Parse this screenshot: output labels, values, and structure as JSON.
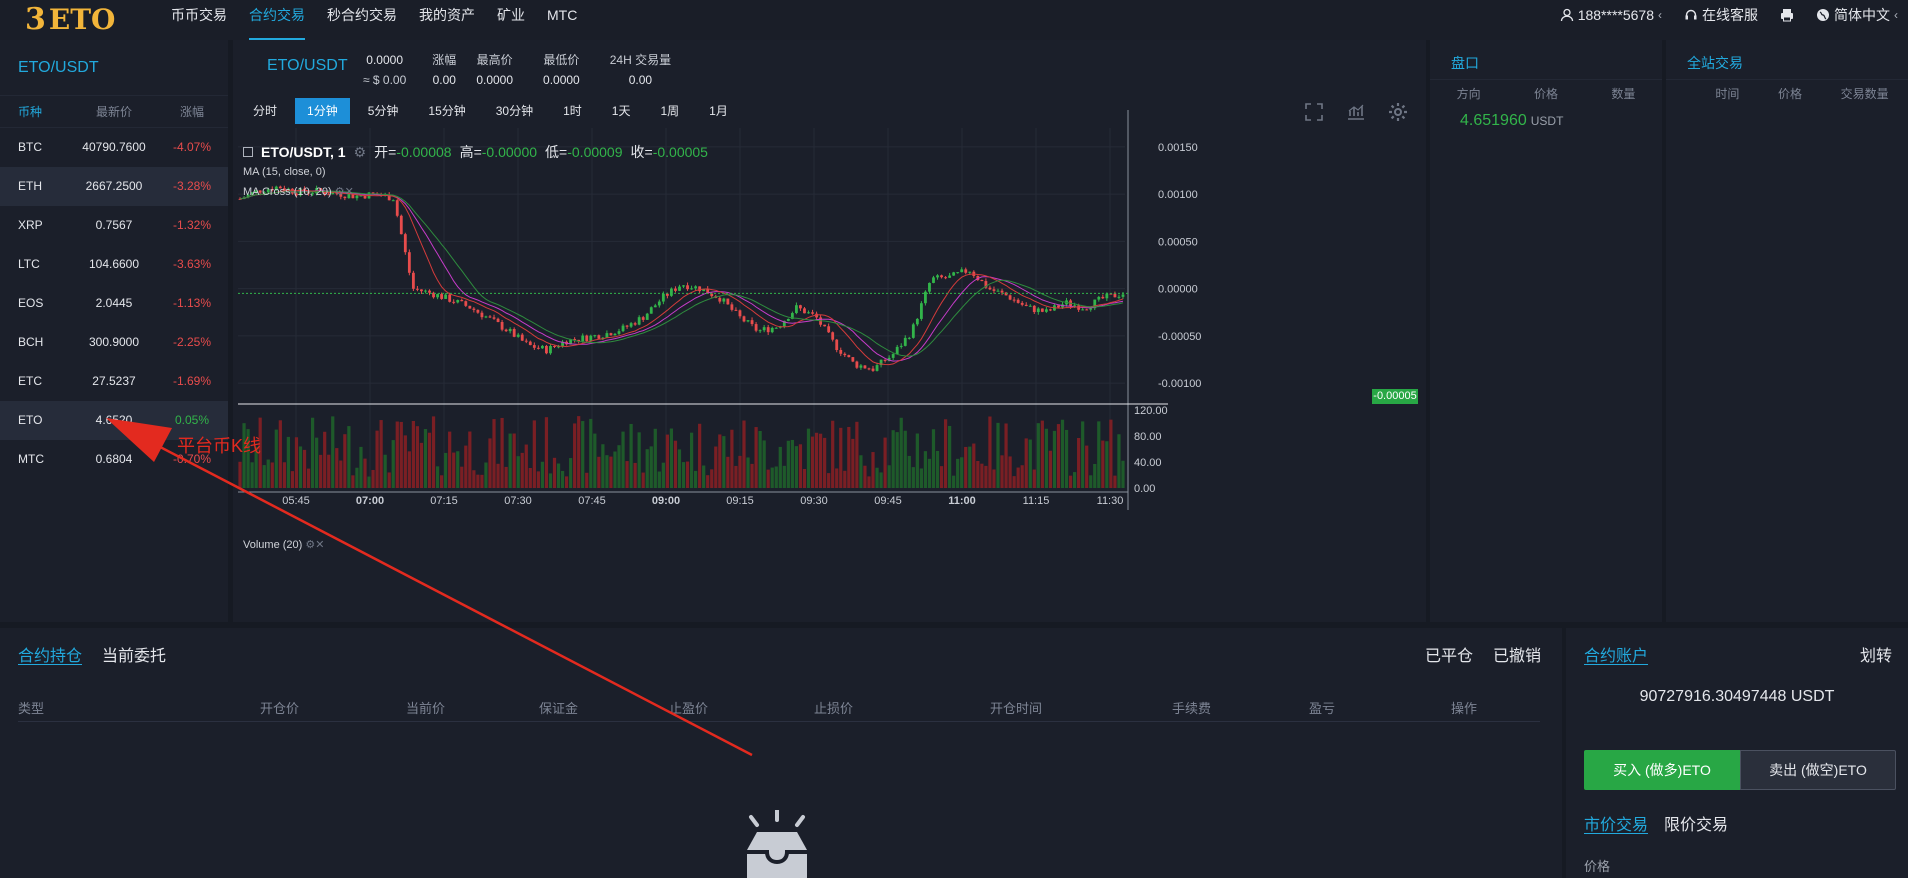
{
  "brand": {
    "mark": "3",
    "name": "ETO"
  },
  "nav": {
    "items": [
      "币币交易",
      "合约交易",
      "秒合约交易",
      "我的资产",
      "矿业",
      "MTC"
    ],
    "active_index": 1,
    "user": "188****5678",
    "support": "在线客服",
    "language": "简体中文"
  },
  "market": {
    "title": "ETO/USDT",
    "headers": [
      "币种",
      "最新价",
      "涨幅"
    ],
    "rows": [
      {
        "coin": "BTC",
        "price": "40790.7600",
        "change": "-4.07%"
      },
      {
        "coin": "ETH",
        "price": "2667.2500",
        "change": "-3.28%"
      },
      {
        "coin": "XRP",
        "price": "0.7567",
        "change": "-1.32%"
      },
      {
        "coin": "LTC",
        "price": "104.6600",
        "change": "-3.63%"
      },
      {
        "coin": "EOS",
        "price": "2.0445",
        "change": "-1.13%"
      },
      {
        "coin": "BCH",
        "price": "300.9000",
        "change": "-2.25%"
      },
      {
        "coin": "ETC",
        "price": "27.5237",
        "change": "-1.69%"
      },
      {
        "coin": "ETO",
        "price": "4.6520",
        "change": "0.05%"
      },
      {
        "coin": "MTC",
        "price": "0.6804",
        "change": "-0.70%"
      }
    ],
    "selected": [
      1,
      7
    ]
  },
  "chart_header": {
    "pair": "ETO/USDT",
    "price": "0.0000",
    "price_usd": "≈ $ 0.00",
    "stats": [
      {
        "label": "涨幅",
        "value": "0.00"
      },
      {
        "label": "最高价",
        "value": "0.0000"
      },
      {
        "label": "最低价",
        "value": "0.0000"
      },
      {
        "label": "24H 交易量",
        "value": "0.00"
      }
    ]
  },
  "timeframes": {
    "items": [
      "分时",
      "1分钟",
      "5分钟",
      "15分钟",
      "30分钟",
      "1时",
      "1天",
      "1周",
      "1月"
    ],
    "active": "1分钟"
  },
  "legend": {
    "symbol": "ETO/USDT, 1",
    "open_label": "开=",
    "open": "-0.00008",
    "high_label": "高=",
    "high": "-0.00000",
    "low_label": "低=",
    "low": "-0.00009",
    "close_label": "收=",
    "close": "-0.00005",
    "ma": "MA (15, close, 0)",
    "ma_cross": "MA Cross (10, 20)",
    "volume": "Volume (20)",
    "current_price_tag": "-0.00005"
  },
  "chart_data": {
    "type": "candlestick",
    "price_axis": [
      "0.00150",
      "0.00100",
      "0.00050",
      "0.00000",
      "-0.00050",
      "-0.00100"
    ],
    "volume_axis": [
      "120.00",
      "80.00",
      "40.00",
      "0.00"
    ],
    "time_axis": [
      "05:45",
      "07:00",
      "07:15",
      "07:30",
      "07:45",
      "09:00",
      "09:15",
      "09:30",
      "09:45",
      "11:00",
      "11:15",
      "11:30"
    ],
    "bold_times": [
      "07:00",
      "09:00",
      "11:00"
    ],
    "ylim": [
      -0.0012,
      0.0017
    ],
    "close_path": [
      0.00095,
      0.00104,
      0.00108,
      0.00102,
      0.00103,
      0.00101,
      0.00098,
      0.001,
      0.00096,
      0.0,
      -5e-05,
      -0.00012,
      -0.0002,
      -0.00032,
      -0.00045,
      -0.0006,
      -0.00065,
      -0.00055,
      -0.00052,
      -0.00048,
      -0.00042,
      -0.0003,
      -0.0001,
      5e-05,
      0.0,
      -0.0001,
      -0.0003,
      -0.00045,
      -0.0004,
      -0.0002,
      -0.0003,
      -0.0006,
      -0.0008,
      -0.00085,
      -0.0007,
      -0.00045,
      0.0001,
      0.00012,
      0.0002,
      0.0,
      -8e-05,
      -0.0002,
      -0.00025,
      -0.00015,
      -0.0002,
      -0.0001,
      -5e-05
    ],
    "current_price": -5e-05,
    "accent": "#22a9dd",
    "up_color": "#32b44a",
    "down_color": "#e74c4c"
  },
  "order_book": {
    "title": "盘口",
    "headers": [
      "方向",
      "价格",
      "数量"
    ],
    "last_price": "4.651960",
    "unit": "USDT"
  },
  "all_trades": {
    "title": "全站交易",
    "headers": [
      "时间",
      "价格",
      "交易数量"
    ]
  },
  "positions": {
    "tabs": [
      "合约持仓",
      "当前委托"
    ],
    "right_tabs": [
      "已平仓",
      "已撤销"
    ],
    "headers": [
      "类型",
      "开仓价",
      "当前价",
      "保证金",
      "止盈价",
      "止损价",
      "开仓时间",
      "手续费",
      "盈亏",
      "操作"
    ]
  },
  "account": {
    "title": "合约账户",
    "transfer": "划转",
    "balance": "90727916.30497448 USDT",
    "buy_label": "买入 (做多)ETO",
    "sell_label": "卖出 (做空)ETO",
    "trade_tabs": [
      "市价交易",
      "限价交易"
    ],
    "price_label": "价格"
  },
  "annotation": {
    "text": "平台币K线"
  }
}
